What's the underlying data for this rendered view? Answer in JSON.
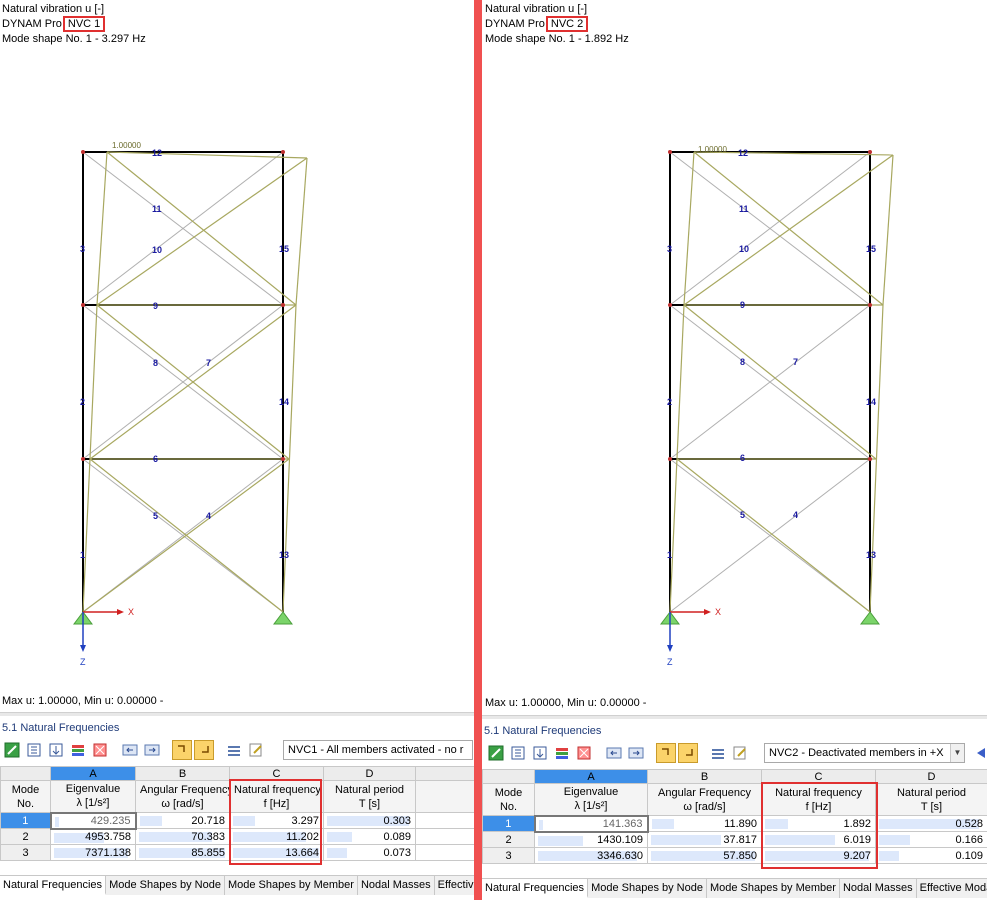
{
  "left": {
    "header": {
      "line1": "Natural vibration u [-]",
      "line2_prefix": "DYNAM Pro",
      "case": "NVC 1",
      "line3": "Mode shape No. 1 - 3.297 Hz"
    },
    "model": {
      "coef": "1.00000",
      "labels": {
        "n12": "12",
        "n11": "11",
        "n10": "10",
        "n9": "9",
        "n8": "8",
        "n7": "7",
        "n6": "6",
        "n5": "5",
        "n4": "4",
        "n3": "3",
        "n2": "2",
        "n1": "1",
        "n15": "15",
        "n14": "14",
        "n13": "13"
      },
      "axis_x": "X",
      "axis_z": "Z"
    },
    "maxmin": "Max u: 1.00000, Min u: 0.00000 -",
    "panel_title": "5.1 Natural Frequencies",
    "combo": "NVC1 - All members activated - no r",
    "table": {
      "letters": [
        "A",
        "B",
        "C",
        "D"
      ],
      "mode_head": [
        "Mode",
        "No."
      ],
      "heads": [
        [
          "Eigenvalue",
          "λ [1/s²]"
        ],
        [
          "Angular Frequency",
          "ω [rad/s]"
        ],
        [
          "Natural frequency",
          "f [Hz]"
        ],
        [
          "Natural period",
          "T [s]"
        ]
      ],
      "rows": [
        {
          "mode": "1",
          "eig": "429.235",
          "ang": "20.718",
          "nat": "3.297",
          "per": "0.303"
        },
        {
          "mode": "2",
          "eig": "4953.758",
          "ang": "70.383",
          "nat": "11.202",
          "per": "0.089"
        },
        {
          "mode": "3",
          "eig": "7371.138",
          "ang": "85.855",
          "nat": "13.664",
          "per": "0.073"
        }
      ]
    },
    "tabs": [
      "Natural Frequencies",
      "Mode Shapes by Node",
      "Mode Shapes by Member",
      "Nodal Masses",
      "Effective"
    ]
  },
  "right": {
    "header": {
      "line1": "Natural vibration u [-]",
      "line2_prefix": "DYNAM Pro",
      "case": "NVC 2",
      "line3": "Mode shape No. 1 - 1.892 Hz"
    },
    "model": {
      "coef": "1.00000",
      "labels": {
        "n12": "12",
        "n11": "11",
        "n10": "10",
        "n9": "9",
        "n8": "8",
        "n7": "7",
        "n6": "6",
        "n5": "5",
        "n4": "4",
        "n3": "3",
        "n2": "2",
        "n1": "1",
        "n15": "15",
        "n14": "14",
        "n13": "13"
      },
      "axis_x": "X",
      "axis_z": "Z"
    },
    "maxmin": "Max u: 1.00000, Min u: 0.00000 -",
    "panel_title": "5.1 Natural Frequencies",
    "combo": "NVC2 - Deactivated members in +X",
    "table": {
      "letters": [
        "A",
        "B",
        "C",
        "D"
      ],
      "mode_head": [
        "Mode",
        "No."
      ],
      "heads": [
        [
          "Eigenvalue",
          "λ [1/s²]"
        ],
        [
          "Angular Frequency",
          "ω [rad/s]"
        ],
        [
          "Natural frequency",
          "f [Hz]"
        ],
        [
          "Natural period",
          "T [s]"
        ]
      ],
      "rows": [
        {
          "mode": "1",
          "eig": "141.363",
          "ang": "11.890",
          "nat": "1.892",
          "per": "0.528"
        },
        {
          "mode": "2",
          "eig": "1430.109",
          "ang": "37.817",
          "nat": "6.019",
          "per": "0.166"
        },
        {
          "mode": "3",
          "eig": "3346.630",
          "ang": "57.850",
          "nat": "9.207",
          "per": "0.109"
        }
      ]
    },
    "tabs": [
      "Natural Frequencies",
      "Mode Shapes by Node",
      "Mode Shapes by Member",
      "Nodal Masses",
      "Effective Moda"
    ]
  },
  "colors": {
    "highlight": "#e03030",
    "divider": "#f05050",
    "selection": "#3d8fe8",
    "deformed": "#a8a860",
    "label": "#1a1aa0"
  }
}
